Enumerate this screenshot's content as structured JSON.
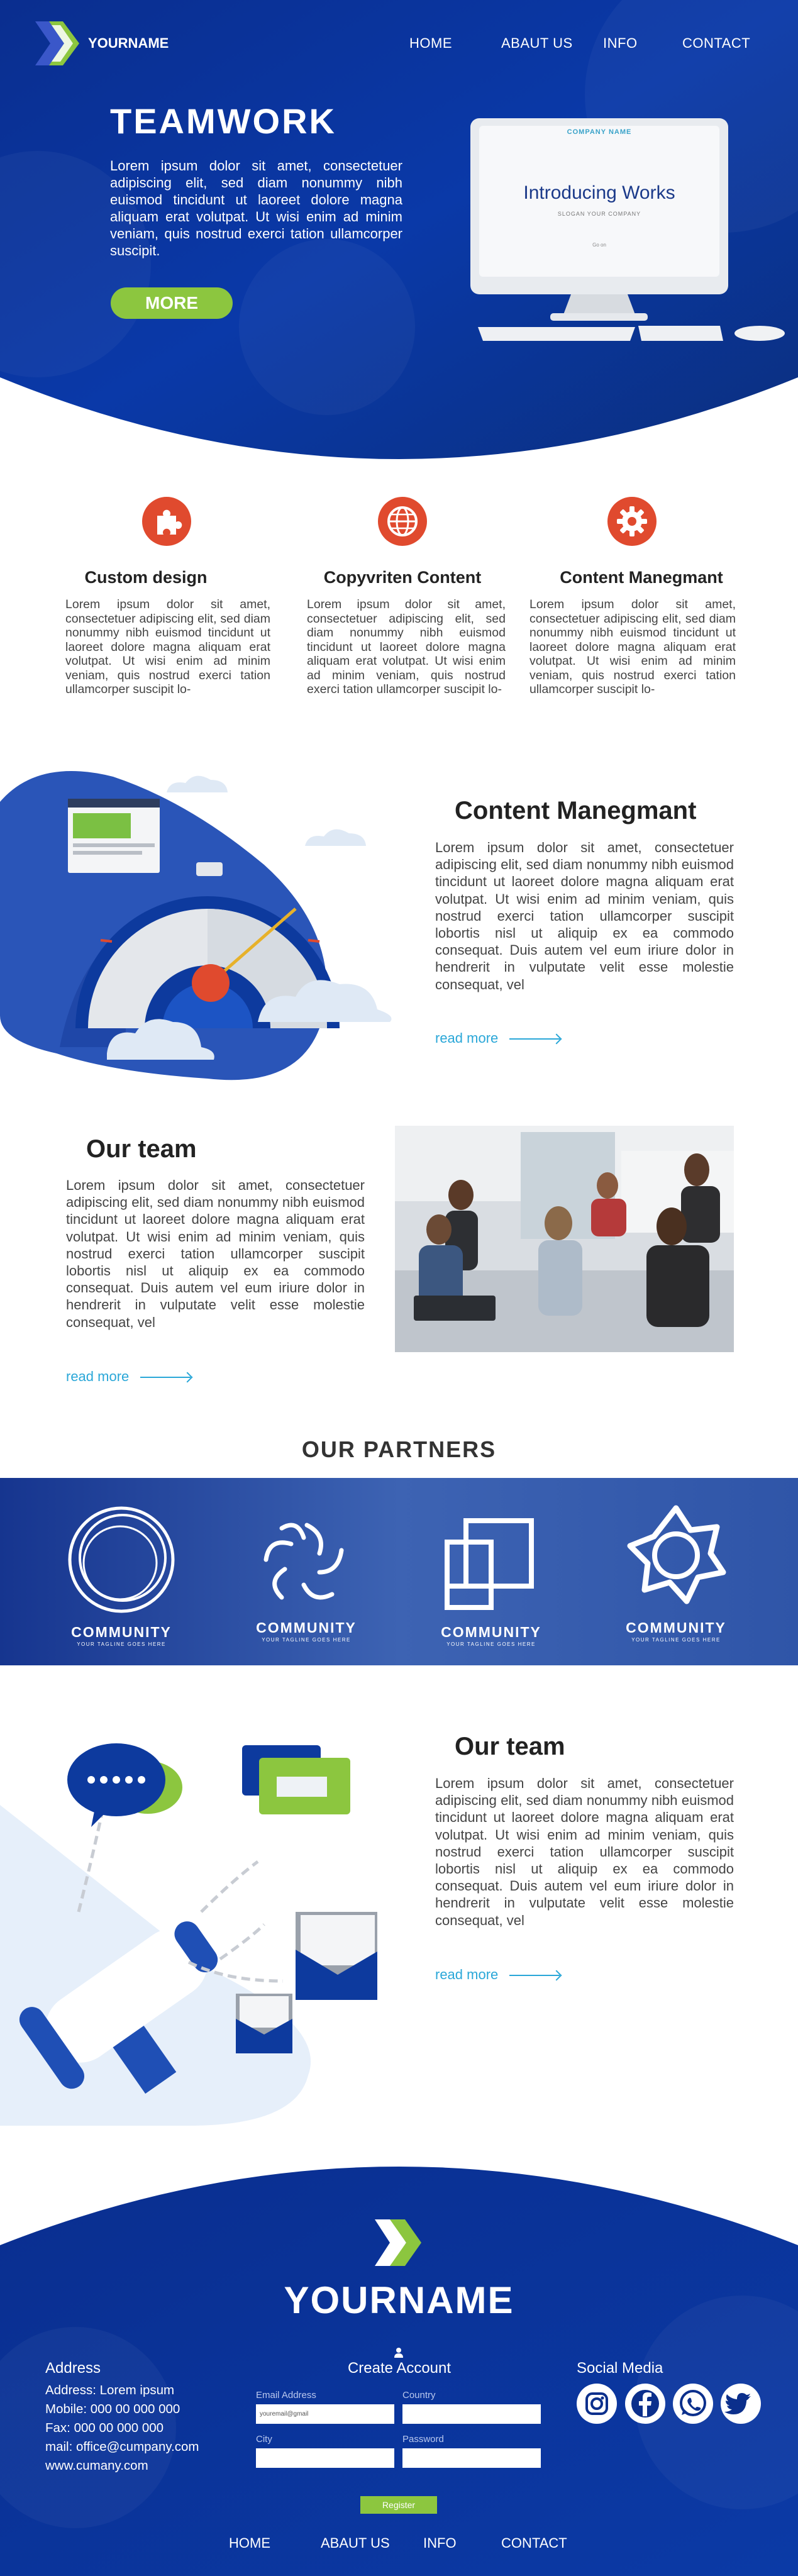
{
  "header": {
    "brand": "YOURNAME",
    "nav": [
      "HOME",
      "ABAUT US",
      "INFO",
      "CONTACT"
    ]
  },
  "hero": {
    "title": "TEAMWORK",
    "text": "Lorem ipsum dolor sit amet, consectetuer adipiscing elit, sed diam nonummy nibh euismod tincidunt ut laoreet dolore magna aliquam erat volutpat. Ut wisi enim ad minim veniam, quis nostrud exerci tation ullamcorper suscipit.",
    "button": "MORE",
    "screen": {
      "company": "COMPANY NAME",
      "title": "Introducing Works",
      "subtitle": "SLOGAN YOUR COMPANY",
      "go": "Go on"
    }
  },
  "features": [
    {
      "icon": "puzzle-icon",
      "title": "Custom design",
      "text": "Lorem ipsum dolor sit amet, consectetuer adipiscing elit, sed diam nonummy nibh euismod tincidunt ut laoreet dolore magna aliquam erat volutpat. Ut wisi enim ad minim veniam, quis nostrud exerci tation ullamcorper suscipit lo-"
    },
    {
      "icon": "globe-icon",
      "title": "Copyvriten Content",
      "text": "Lorem ipsum dolor sit amet, consectetuer adipiscing elit, sed diam nonummy nibh euismod tincidunt ut laoreet dolore magna aliquam erat volutpat. Ut wisi enim ad minim veniam, quis nostrud exerci tation ullamcorper suscipit lo-"
    },
    {
      "icon": "gear-icon",
      "title": "Content Manegmant",
      "text": "Lorem ipsum dolor sit amet, consectetuer adipiscing elit, sed diam nonummy nibh euismod tincidunt ut laoreet dolore magna aliquam erat volutpat. Ut wisi enim ad minim veniam, quis nostrud exerci tation ullamcorper suscipit lo-"
    }
  ],
  "content_section": {
    "title": "Content Manegmant",
    "text": "Lorem ipsum dolor sit amet, consectetuer adipiscing elit, sed diam nonummy nibh euismod tincidunt ut laoreet dolore magna aliquam erat volutpat. Ut wisi enim ad minim veniam, quis nostrud exerci tation ullamcorper suscipit lobortis nisl ut aliquip ex ea commodo consequat. Duis autem vel eum iriure dolor in hendrerit in vulputate velit esse molestie consequat, vel",
    "read_more": "read more"
  },
  "team_section": {
    "title": "Our team",
    "text": "Lorem ipsum dolor sit amet, consectetuer adipiscing elit, sed diam nonummy nibh euismod tincidunt ut laoreet dolore magna aliquam erat volutpat. Ut wisi enim ad minim veniam, quis nostrud exerci tation ullamcorper suscipit lobortis nisl ut aliquip ex ea commodo consequat. Duis autem vel eum iriure dolor in hendrerit in vulputate velit esse molestie consequat, vel",
    "read_more": "read more"
  },
  "partners": {
    "title": "OUR PARTNERS",
    "items": [
      {
        "name": "COMMUNITY",
        "tagline": "YOUR TAGLINE GOES HERE"
      },
      {
        "name": "COMMUNITY",
        "tagline": "YOUR TAGLINE GOES HERE"
      },
      {
        "name": "COMMUNITY",
        "tagline": "YOUR TAGLINE GOES HERE"
      },
      {
        "name": "COMMUNITY",
        "tagline": "YOUR TAGLINE GOES HERE"
      }
    ]
  },
  "team_section_2": {
    "title": "Our team",
    "text": "Lorem ipsum dolor sit amet, consectetuer adipiscing elit, sed diam nonummy nibh euismod tincidunt ut laoreet dolore magna aliquam erat volutpat. Ut wisi enim ad minim veniam, quis nostrud exerci tation ullamcorper suscipit lobortis nisl ut aliquip ex ea commodo consequat. Duis autem vel eum iriure dolor in hendrerit in vulputate velit esse molestie consequat, vel",
    "read_more": "read more"
  },
  "footer": {
    "brand": "YOURNAME",
    "address": {
      "heading": "Address",
      "lines": [
        "Address: Lorem ipsum",
        "Mobile: 000 00 000 000",
        "Fax: 000 00 000 000",
        "mail: office@cumpany.com",
        "www.cumany.com"
      ]
    },
    "account": {
      "heading": "Create Account",
      "email_label": "Email Address",
      "email_value": "youremail@gmail",
      "country_label": "Country",
      "city_label": "City",
      "password_label": "Password",
      "register": "Register"
    },
    "social": {
      "heading": "Social Media",
      "icons": [
        "instagram-icon",
        "facebook-icon",
        "whatsapp-icon",
        "twitter-icon"
      ]
    },
    "nav": [
      "HOME",
      "ABAUT US",
      "INFO",
      "CONTACT"
    ]
  },
  "colors": {
    "primary_blue": "#0b2f8c",
    "accent_green": "#8cc63f",
    "accent_red": "#e04a2e",
    "link_blue": "#2aa7d8"
  }
}
